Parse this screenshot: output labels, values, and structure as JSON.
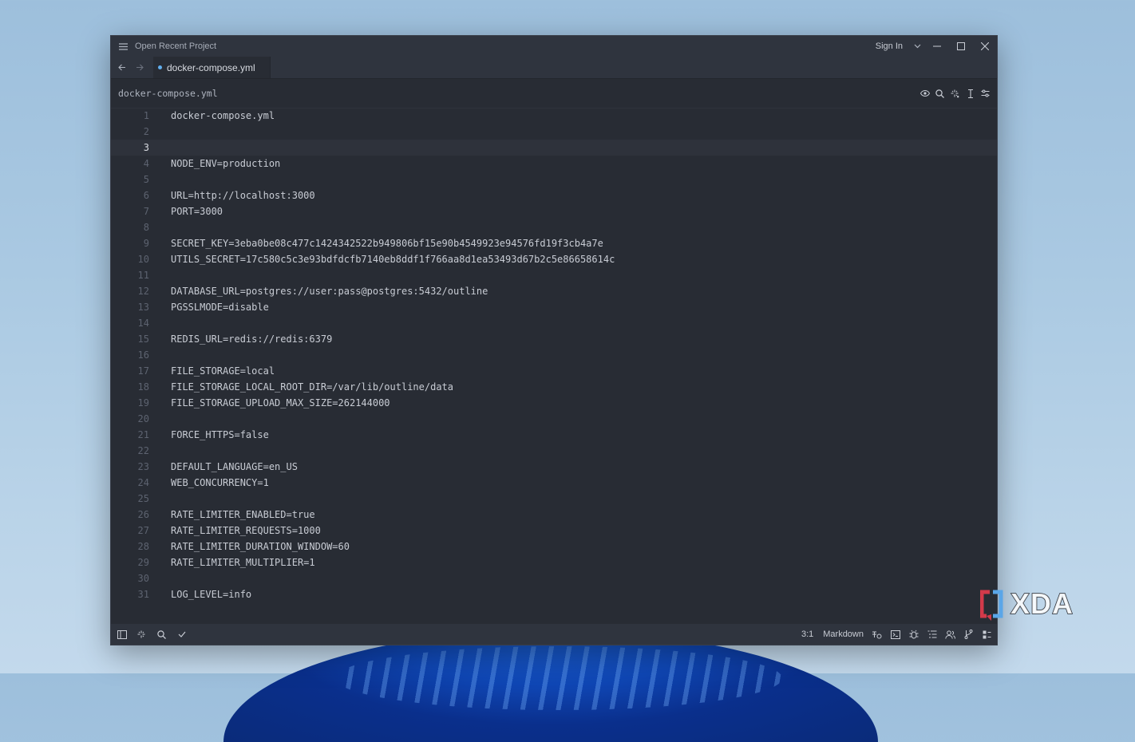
{
  "titlebar": {
    "menu_icon": "hamburger-icon",
    "project_label": "Open Recent Project",
    "sign_in_label": "Sign In"
  },
  "tabs": [
    {
      "label": "docker-compose.yml",
      "modified": true
    }
  ],
  "breadcrumb": {
    "file": "docker-compose.yml"
  },
  "editor": {
    "active_line": 3,
    "lines": [
      {
        "num": "1",
        "text": "docker-compose.yml"
      },
      {
        "num": "2",
        "text": ""
      },
      {
        "num": "3",
        "text": ""
      },
      {
        "num": "4",
        "text": "NODE_ENV=production"
      },
      {
        "num": "5",
        "text": ""
      },
      {
        "num": "6",
        "text": "URL=http://localhost:3000"
      },
      {
        "num": "7",
        "text": "PORT=3000"
      },
      {
        "num": "8",
        "text": ""
      },
      {
        "num": "9",
        "text": "SECRET_KEY=3eba0be08c477c1424342522b949806bf15e90b4549923e94576fd19f3cb4a7e"
      },
      {
        "num": "10",
        "text": "UTILS_SECRET=17c580c5c3e93bdfdcfb7140eb8ddf1f766aa8d1ea53493d67b2c5e86658614c"
      },
      {
        "num": "11",
        "text": ""
      },
      {
        "num": "12",
        "text": "DATABASE_URL=postgres://user:pass@postgres:5432/outline"
      },
      {
        "num": "13",
        "text": "PGSSLMODE=disable"
      },
      {
        "num": "14",
        "text": ""
      },
      {
        "num": "15",
        "text": "REDIS_URL=redis://redis:6379"
      },
      {
        "num": "16",
        "text": ""
      },
      {
        "num": "17",
        "text": "FILE_STORAGE=local"
      },
      {
        "num": "18",
        "text": "FILE_STORAGE_LOCAL_ROOT_DIR=/var/lib/outline/data"
      },
      {
        "num": "19",
        "text": "FILE_STORAGE_UPLOAD_MAX_SIZE=262144000"
      },
      {
        "num": "20",
        "text": ""
      },
      {
        "num": "21",
        "text": "FORCE_HTTPS=false"
      },
      {
        "num": "22",
        "text": ""
      },
      {
        "num": "23",
        "text": "DEFAULT_LANGUAGE=en_US"
      },
      {
        "num": "24",
        "text": "WEB_CONCURRENCY=1"
      },
      {
        "num": "25",
        "text": ""
      },
      {
        "num": "26",
        "text": "RATE_LIMITER_ENABLED=true"
      },
      {
        "num": "27",
        "text": "RATE_LIMITER_REQUESTS=1000"
      },
      {
        "num": "28",
        "text": "RATE_LIMITER_DURATION_WINDOW=60"
      },
      {
        "num": "29",
        "text": "RATE_LIMITER_MULTIPLIER=1"
      },
      {
        "num": "30",
        "text": ""
      },
      {
        "num": "31",
        "text": "LOG_LEVEL=info"
      }
    ]
  },
  "statusbar": {
    "cursor_position": "3:1",
    "language": "Markdown"
  },
  "watermark": {
    "text": "XDA"
  },
  "colors": {
    "editor_bg": "#282c34",
    "chrome_bg": "#2f343e",
    "text": "#c8ccd4",
    "line_number": "#5d6370",
    "tab_modified_dot": "#61afef"
  }
}
